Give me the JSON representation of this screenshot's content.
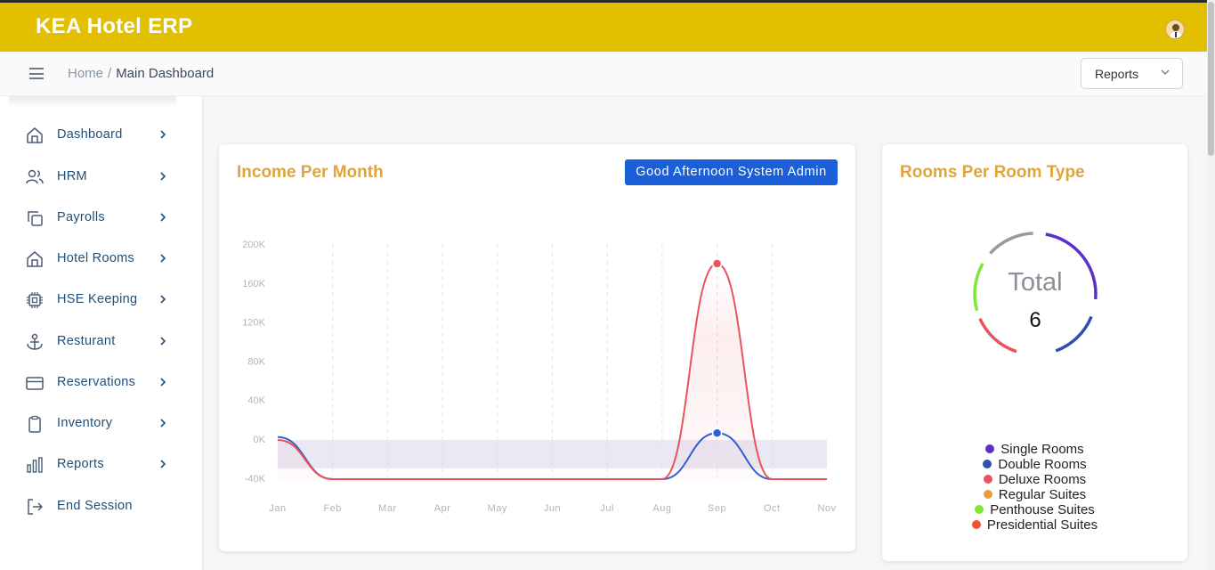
{
  "app": {
    "brand": "KEA Hotel ERP"
  },
  "breadcrumb": {
    "home": "Home",
    "separator": "/",
    "current": "Main Dashboard"
  },
  "header": {
    "reports_dropdown": "Reports"
  },
  "sidebar": {
    "items": [
      {
        "label": "Dashboard",
        "icon": "home-icon"
      },
      {
        "label": "HRM",
        "icon": "users-icon"
      },
      {
        "label": "Payrolls",
        "icon": "copy-icon"
      },
      {
        "label": "Hotel Rooms",
        "icon": "home-icon"
      },
      {
        "label": "HSE Keeping",
        "icon": "cpu-icon"
      },
      {
        "label": "Resturant",
        "icon": "anchor-icon"
      },
      {
        "label": "Reservations",
        "icon": "credit-card-icon"
      },
      {
        "label": "Inventory",
        "icon": "clipboard-icon"
      },
      {
        "label": "Reports",
        "icon": "bar-chart-icon"
      },
      {
        "label": "End Session",
        "icon": "log-out-icon"
      }
    ]
  },
  "income_card": {
    "title": "Income Per Month",
    "greeting": "Good Afternoon System Admin"
  },
  "rooms_card": {
    "title": "Rooms Per Room Type",
    "total_label": "Total",
    "total_value": "6"
  },
  "colors": {
    "accent": "#e2c000",
    "title": "#e0a43c",
    "button": "#1b5fd8",
    "nav_text": "#1f4e79"
  },
  "chart_data": [
    {
      "type": "area",
      "categories": [
        "Jan",
        "Feb",
        "Mar",
        "Apr",
        "May",
        "Jun",
        "Jul",
        "Aug",
        "Sep",
        "Oct",
        "Nov"
      ],
      "y_ticks": [
        "200K",
        "160K",
        "120K",
        "80K",
        "40K",
        "0K",
        "-40K"
      ],
      "ylim": [
        -40000,
        200000
      ],
      "series": [
        {
          "color": "#2f5fd6",
          "values": [
            3000,
            -40000,
            -40000,
            -40000,
            -40000,
            -40000,
            -40000,
            -40000,
            7000,
            -40000,
            -40000
          ]
        },
        {
          "color": "#e8545c",
          "values": [
            0,
            -40000,
            -40000,
            -40000,
            -40000,
            -40000,
            -40000,
            -40000,
            180000,
            -40000,
            -40000
          ]
        }
      ],
      "grid": "vertical dashed"
    },
    {
      "type": "pie",
      "variant": "radial ring",
      "legend": [
        {
          "label": "Single Rooms",
          "color": "#5b2fc9"
        },
        {
          "label": "Double Rooms",
          "color": "#2f4fa8"
        },
        {
          "label": "Deluxe Rooms",
          "color": "#e8545c"
        },
        {
          "label": "Regular Suites",
          "color": "#e4a03c"
        },
        {
          "label": "Penthouse Suites",
          "color": "#7ee83a"
        },
        {
          "label": "Presidential Suites",
          "color": "#f0532e"
        }
      ]
    }
  ]
}
